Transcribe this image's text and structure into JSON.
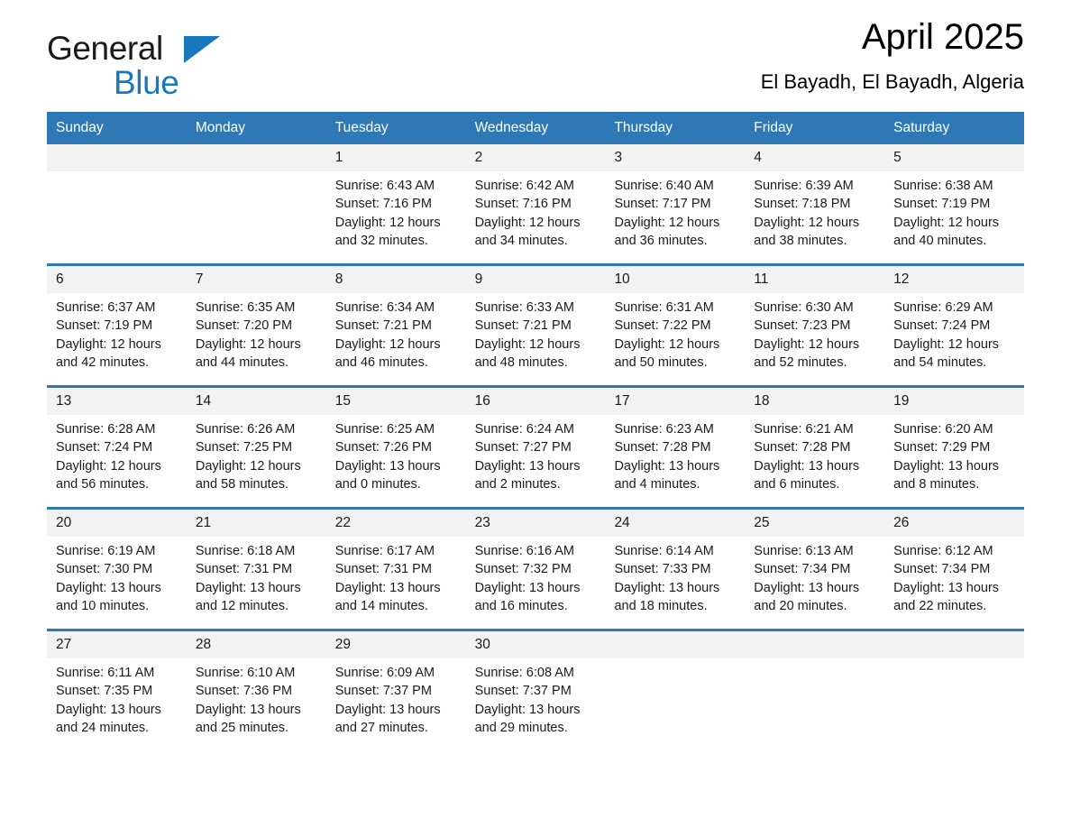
{
  "brand": {
    "name_part1": "General",
    "name_part2": "Blue",
    "flag_icon": "triangle-flag-icon",
    "accent_color": "#1878be"
  },
  "header": {
    "title": "April 2025",
    "subtitle": "El Bayadh, El Bayadh, Algeria"
  },
  "calendar": {
    "header_color": "#2e79b5",
    "weekdays": [
      "Sunday",
      "Monday",
      "Tuesday",
      "Wednesday",
      "Thursday",
      "Friday",
      "Saturday"
    ],
    "weeks": [
      [
        {
          "date": "",
          "sunrise": "",
          "sunset": "",
          "daylight1": "",
          "daylight2": "",
          "empty": true
        },
        {
          "date": "",
          "sunrise": "",
          "sunset": "",
          "daylight1": "",
          "daylight2": "",
          "empty": true
        },
        {
          "date": "1",
          "sunrise": "Sunrise: 6:43 AM",
          "sunset": "Sunset: 7:16 PM",
          "daylight1": "Daylight: 12 hours",
          "daylight2": "and 32 minutes."
        },
        {
          "date": "2",
          "sunrise": "Sunrise: 6:42 AM",
          "sunset": "Sunset: 7:16 PM",
          "daylight1": "Daylight: 12 hours",
          "daylight2": "and 34 minutes."
        },
        {
          "date": "3",
          "sunrise": "Sunrise: 6:40 AM",
          "sunset": "Sunset: 7:17 PM",
          "daylight1": "Daylight: 12 hours",
          "daylight2": "and 36 minutes."
        },
        {
          "date": "4",
          "sunrise": "Sunrise: 6:39 AM",
          "sunset": "Sunset: 7:18 PM",
          "daylight1": "Daylight: 12 hours",
          "daylight2": "and 38 minutes."
        },
        {
          "date": "5",
          "sunrise": "Sunrise: 6:38 AM",
          "sunset": "Sunset: 7:19 PM",
          "daylight1": "Daylight: 12 hours",
          "daylight2": "and 40 minutes."
        }
      ],
      [
        {
          "date": "6",
          "sunrise": "Sunrise: 6:37 AM",
          "sunset": "Sunset: 7:19 PM",
          "daylight1": "Daylight: 12 hours",
          "daylight2": "and 42 minutes."
        },
        {
          "date": "7",
          "sunrise": "Sunrise: 6:35 AM",
          "sunset": "Sunset: 7:20 PM",
          "daylight1": "Daylight: 12 hours",
          "daylight2": "and 44 minutes."
        },
        {
          "date": "8",
          "sunrise": "Sunrise: 6:34 AM",
          "sunset": "Sunset: 7:21 PM",
          "daylight1": "Daylight: 12 hours",
          "daylight2": "and 46 minutes."
        },
        {
          "date": "9",
          "sunrise": "Sunrise: 6:33 AM",
          "sunset": "Sunset: 7:21 PM",
          "daylight1": "Daylight: 12 hours",
          "daylight2": "and 48 minutes."
        },
        {
          "date": "10",
          "sunrise": "Sunrise: 6:31 AM",
          "sunset": "Sunset: 7:22 PM",
          "daylight1": "Daylight: 12 hours",
          "daylight2": "and 50 minutes."
        },
        {
          "date": "11",
          "sunrise": "Sunrise: 6:30 AM",
          "sunset": "Sunset: 7:23 PM",
          "daylight1": "Daylight: 12 hours",
          "daylight2": "and 52 minutes."
        },
        {
          "date": "12",
          "sunrise": "Sunrise: 6:29 AM",
          "sunset": "Sunset: 7:24 PM",
          "daylight1": "Daylight: 12 hours",
          "daylight2": "and 54 minutes."
        }
      ],
      [
        {
          "date": "13",
          "sunrise": "Sunrise: 6:28 AM",
          "sunset": "Sunset: 7:24 PM",
          "daylight1": "Daylight: 12 hours",
          "daylight2": "and 56 minutes."
        },
        {
          "date": "14",
          "sunrise": "Sunrise: 6:26 AM",
          "sunset": "Sunset: 7:25 PM",
          "daylight1": "Daylight: 12 hours",
          "daylight2": "and 58 minutes."
        },
        {
          "date": "15",
          "sunrise": "Sunrise: 6:25 AM",
          "sunset": "Sunset: 7:26 PM",
          "daylight1": "Daylight: 13 hours",
          "daylight2": "and 0 minutes."
        },
        {
          "date": "16",
          "sunrise": "Sunrise: 6:24 AM",
          "sunset": "Sunset: 7:27 PM",
          "daylight1": "Daylight: 13 hours",
          "daylight2": "and 2 minutes."
        },
        {
          "date": "17",
          "sunrise": "Sunrise: 6:23 AM",
          "sunset": "Sunset: 7:28 PM",
          "daylight1": "Daylight: 13 hours",
          "daylight2": "and 4 minutes."
        },
        {
          "date": "18",
          "sunrise": "Sunrise: 6:21 AM",
          "sunset": "Sunset: 7:28 PM",
          "daylight1": "Daylight: 13 hours",
          "daylight2": "and 6 minutes."
        },
        {
          "date": "19",
          "sunrise": "Sunrise: 6:20 AM",
          "sunset": "Sunset: 7:29 PM",
          "daylight1": "Daylight: 13 hours",
          "daylight2": "and 8 minutes."
        }
      ],
      [
        {
          "date": "20",
          "sunrise": "Sunrise: 6:19 AM",
          "sunset": "Sunset: 7:30 PM",
          "daylight1": "Daylight: 13 hours",
          "daylight2": "and 10 minutes."
        },
        {
          "date": "21",
          "sunrise": "Sunrise: 6:18 AM",
          "sunset": "Sunset: 7:31 PM",
          "daylight1": "Daylight: 13 hours",
          "daylight2": "and 12 minutes."
        },
        {
          "date": "22",
          "sunrise": "Sunrise: 6:17 AM",
          "sunset": "Sunset: 7:31 PM",
          "daylight1": "Daylight: 13 hours",
          "daylight2": "and 14 minutes."
        },
        {
          "date": "23",
          "sunrise": "Sunrise: 6:16 AM",
          "sunset": "Sunset: 7:32 PM",
          "daylight1": "Daylight: 13 hours",
          "daylight2": "and 16 minutes."
        },
        {
          "date": "24",
          "sunrise": "Sunrise: 6:14 AM",
          "sunset": "Sunset: 7:33 PM",
          "daylight1": "Daylight: 13 hours",
          "daylight2": "and 18 minutes."
        },
        {
          "date": "25",
          "sunrise": "Sunrise: 6:13 AM",
          "sunset": "Sunset: 7:34 PM",
          "daylight1": "Daylight: 13 hours",
          "daylight2": "and 20 minutes."
        },
        {
          "date": "26",
          "sunrise": "Sunrise: 6:12 AM",
          "sunset": "Sunset: 7:34 PM",
          "daylight1": "Daylight: 13 hours",
          "daylight2": "and 22 minutes."
        }
      ],
      [
        {
          "date": "27",
          "sunrise": "Sunrise: 6:11 AM",
          "sunset": "Sunset: 7:35 PM",
          "daylight1": "Daylight: 13 hours",
          "daylight2": "and 24 minutes."
        },
        {
          "date": "28",
          "sunrise": "Sunrise: 6:10 AM",
          "sunset": "Sunset: 7:36 PM",
          "daylight1": "Daylight: 13 hours",
          "daylight2": "and 25 minutes."
        },
        {
          "date": "29",
          "sunrise": "Sunrise: 6:09 AM",
          "sunset": "Sunset: 7:37 PM",
          "daylight1": "Daylight: 13 hours",
          "daylight2": "and 27 minutes."
        },
        {
          "date": "30",
          "sunrise": "Sunrise: 6:08 AM",
          "sunset": "Sunset: 7:37 PM",
          "daylight1": "Daylight: 13 hours",
          "daylight2": "and 29 minutes."
        },
        {
          "date": "",
          "sunrise": "",
          "sunset": "",
          "daylight1": "",
          "daylight2": "",
          "empty": true
        },
        {
          "date": "",
          "sunrise": "",
          "sunset": "",
          "daylight1": "",
          "daylight2": "",
          "empty": true
        },
        {
          "date": "",
          "sunrise": "",
          "sunset": "",
          "daylight1": "",
          "daylight2": "",
          "empty": true
        }
      ]
    ]
  }
}
